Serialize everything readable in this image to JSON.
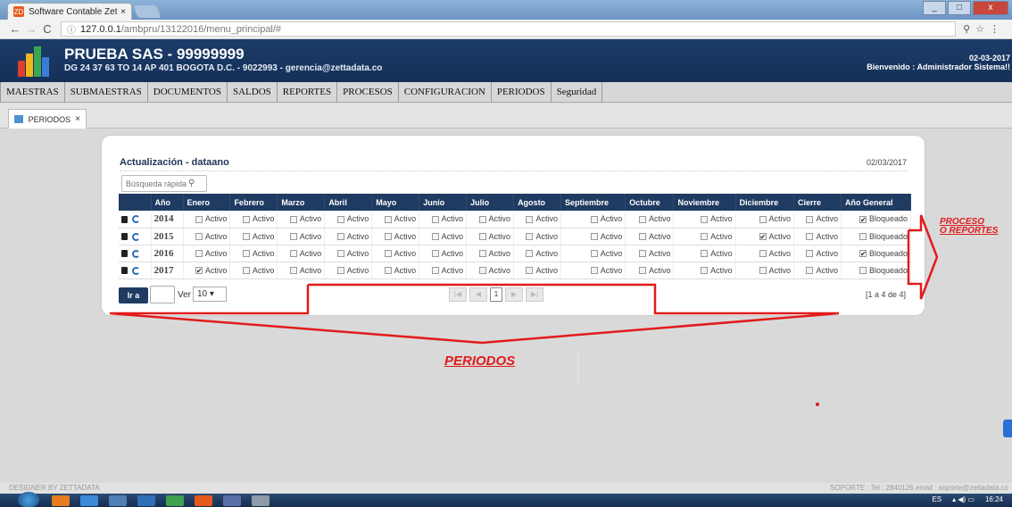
{
  "browser": {
    "tab_title": "Software Contable Zetta",
    "tab_close": "×",
    "favicon": "ZD",
    "url_host": "127.0.0.1",
    "url_path": "/ambpru/13122016/menu_principal/#",
    "win_controls": [
      "_",
      "□",
      "x"
    ]
  },
  "header": {
    "company": "PRUEBA SAS - 99999999",
    "address": "DG 24 37 63 TO 14 AP 401 BOGOTA D.C. - 9022993 - gerencia@zettadata.co",
    "date": "02-03-2017",
    "welcome": "Bienvenido : Administrador Sistema!!"
  },
  "menu": [
    "MAESTRAS",
    "SUBMAESTRAS",
    "DOCUMENTOS",
    "SALDOS",
    "REPORTES",
    "PROCESOS",
    "CONFIGURACION",
    "PERIODOS",
    "Seguridad"
  ],
  "page_tab": {
    "label": "PERIODOS",
    "close": "×"
  },
  "card": {
    "title": "Actualización - dataano",
    "date": "02/03/2017",
    "search_placeholder": "Búsqueda rápida"
  },
  "table": {
    "headers": [
      "",
      "Año",
      "Enero",
      "Febrero",
      "Marzo",
      "Abril",
      "Mayo",
      "Junio",
      "Julio",
      "Agosto",
      "Septiembre",
      "Octubre",
      "Noviembre",
      "Diciembre",
      "Cierre",
      "Año General"
    ],
    "rows": [
      {
        "year": "2014",
        "cells": [
          {
            "label": "Activo",
            "checked": false
          },
          {
            "label": "Activo",
            "checked": false
          },
          {
            "label": "Activo",
            "checked": false
          },
          {
            "label": "Activo",
            "checked": false
          },
          {
            "label": "Activo",
            "checked": false
          },
          {
            "label": "Activo",
            "checked": false
          },
          {
            "label": "Activo",
            "checked": false
          },
          {
            "label": "Activo",
            "checked": false
          },
          {
            "label": "Activo",
            "checked": false
          },
          {
            "label": "Activo",
            "checked": false
          },
          {
            "label": "Activo",
            "checked": false
          },
          {
            "label": "Activo",
            "checked": false
          },
          {
            "label": "Activo",
            "checked": false
          },
          {
            "label": "Bloqueado",
            "checked": true
          }
        ]
      },
      {
        "year": "2015",
        "cells": [
          {
            "label": "Activo",
            "checked": false
          },
          {
            "label": "Activo",
            "checked": false
          },
          {
            "label": "Activo",
            "checked": false
          },
          {
            "label": "Activo",
            "checked": false
          },
          {
            "label": "Activo",
            "checked": false
          },
          {
            "label": "Activo",
            "checked": false
          },
          {
            "label": "Activo",
            "checked": false
          },
          {
            "label": "Activo",
            "checked": false
          },
          {
            "label": "Activo",
            "checked": false
          },
          {
            "label": "Activo",
            "checked": false
          },
          {
            "label": "Activo",
            "checked": false
          },
          {
            "label": "Activo",
            "checked": true
          },
          {
            "label": "Activo",
            "checked": false
          },
          {
            "label": "Bloqueado",
            "checked": false
          }
        ]
      },
      {
        "year": "2016",
        "cells": [
          {
            "label": "Activo",
            "checked": false
          },
          {
            "label": "Activo",
            "checked": false
          },
          {
            "label": "Activo",
            "checked": false
          },
          {
            "label": "Activo",
            "checked": false
          },
          {
            "label": "Activo",
            "checked": false
          },
          {
            "label": "Activo",
            "checked": false
          },
          {
            "label": "Activo",
            "checked": false
          },
          {
            "label": "Activo",
            "checked": false
          },
          {
            "label": "Activo",
            "checked": false
          },
          {
            "label": "Activo",
            "checked": false
          },
          {
            "label": "Activo",
            "checked": false
          },
          {
            "label": "Activo",
            "checked": false
          },
          {
            "label": "Activo",
            "checked": false
          },
          {
            "label": "Bloqueado",
            "checked": true
          }
        ]
      },
      {
        "year": "2017",
        "cells": [
          {
            "label": "Activo",
            "checked": true
          },
          {
            "label": "Activo",
            "checked": false
          },
          {
            "label": "Activo",
            "checked": false
          },
          {
            "label": "Activo",
            "checked": false
          },
          {
            "label": "Activo",
            "checked": false
          },
          {
            "label": "Activo",
            "checked": false
          },
          {
            "label": "Activo",
            "checked": false
          },
          {
            "label": "Activo",
            "checked": false
          },
          {
            "label": "Activo",
            "checked": false
          },
          {
            "label": "Activo",
            "checked": false
          },
          {
            "label": "Activo",
            "checked": false
          },
          {
            "label": "Activo",
            "checked": false
          },
          {
            "label": "Activo",
            "checked": false
          },
          {
            "label": "Bloqueado",
            "checked": false
          }
        ]
      }
    ]
  },
  "pager": {
    "go_label": "Ir a",
    "ver_label": "Ver",
    "page_size": "10",
    "current_page": "1",
    "info": "[1 a 4 de 4]"
  },
  "annotations": {
    "proceso": "PROCESO",
    "o_reportes": "O REPORTES",
    "periodos": "PERIODOS",
    "color": "#e21b1b"
  },
  "footer": {
    "left": "DESIGNER BY ZETTADATA",
    "right": "SOPORTE : Tel : 2840126 email : soporte@zettadata.co"
  },
  "taskbar": {
    "lang": "ES",
    "time": "16:24"
  }
}
